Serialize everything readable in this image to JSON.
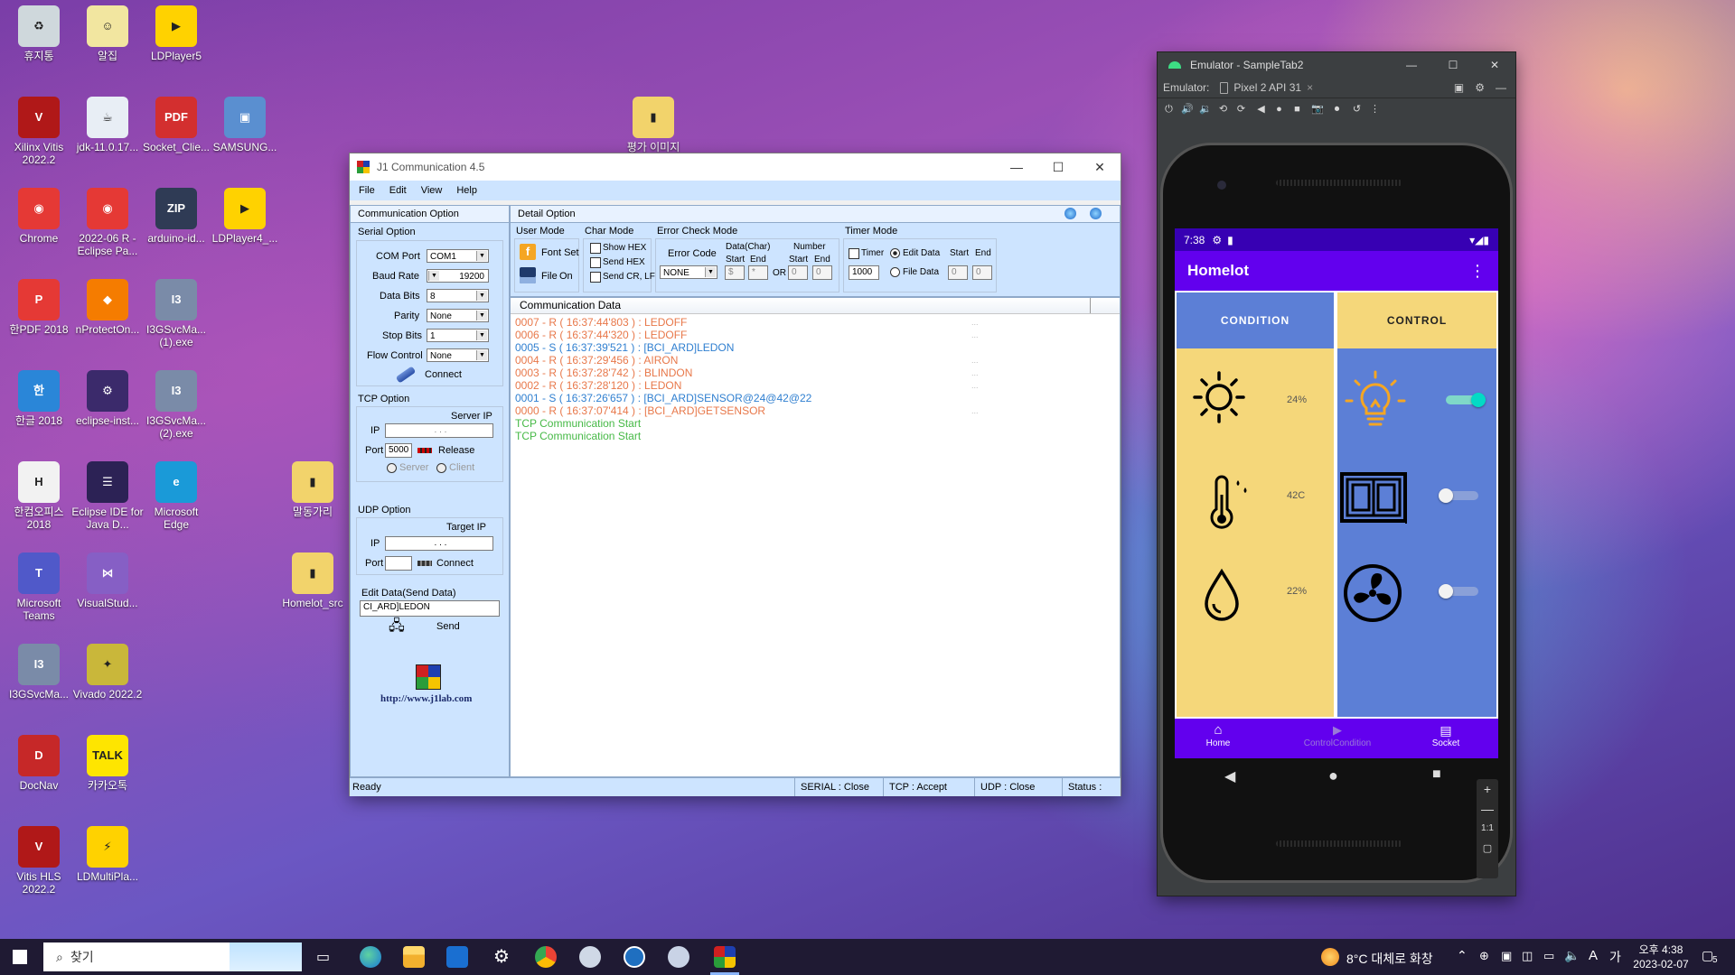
{
  "desktop": {
    "icons": [
      {
        "label": "휴지통",
        "icon": "recycle-bin-icon",
        "color": "#cfd8dc",
        "glyph": "♻"
      },
      {
        "label": "알집",
        "icon": "alzip-icon",
        "color": "#f2e6a0",
        "glyph": "☺"
      },
      {
        "label": "LDPlayer5",
        "icon": "ldplayer-icon",
        "color": "#ffd200",
        "glyph": "▶"
      },
      {
        "label": "Xilinx Vitis 2022.2",
        "icon": "vitis-icon",
        "color": "#b01818",
        "glyph": "V"
      },
      {
        "label": "jdk-11.0.17...",
        "icon": "java-icon",
        "color": "#e8eef5",
        "glyph": "☕"
      },
      {
        "label": "Socket_Clie...",
        "icon": "pdf-icon",
        "color": "#d32f2f",
        "glyph": "PDF"
      },
      {
        "label": "SAMSUNG...",
        "icon": "samsung-setup-icon",
        "color": "#5a8fd0",
        "glyph": "▣"
      },
      {
        "label": "Chrome",
        "icon": "chrome-icon",
        "color": "#e53935",
        "glyph": "◉"
      },
      {
        "label": "2022-06 R - Eclipse Pa...",
        "icon": "chrome-icon",
        "color": "#e53935",
        "glyph": "◉"
      },
      {
        "label": "arduino-id...",
        "icon": "zip-icon",
        "color": "#2f3b55",
        "glyph": "ZIP"
      },
      {
        "label": "LDPlayer4_...",
        "icon": "ldplayer-icon",
        "color": "#ffd200",
        "glyph": "▶"
      },
      {
        "label": "한PDF 2018",
        "icon": "hanpdf-icon",
        "color": "#e53935",
        "glyph": "P"
      },
      {
        "label": "nProtectOn...",
        "icon": "nprotect-icon",
        "color": "#f57c00",
        "glyph": "◆"
      },
      {
        "label": "I3GSvcMa... (1).exe",
        "icon": "installer-icon",
        "color": "#7a8ba8",
        "glyph": "I3"
      },
      {
        "label": "한글 2018",
        "icon": "hangul-icon",
        "color": "#2a86d8",
        "glyph": "한"
      },
      {
        "label": "eclipse-inst...",
        "icon": "eclipse-installer-icon",
        "color": "#3b2a6b",
        "glyph": "⚙"
      },
      {
        "label": "I3GSvcMa... (2).exe",
        "icon": "installer-icon",
        "color": "#7a8ba8",
        "glyph": "I3"
      },
      {
        "label": "한컴오피스 2018",
        "icon": "hancom-icon",
        "color": "#f2f2f2",
        "glyph": "H"
      },
      {
        "label": "Eclipse IDE for Java D...",
        "icon": "eclipse-icon",
        "color": "#2c2255",
        "glyph": "☰"
      },
      {
        "label": "Microsoft Edge",
        "icon": "edge-icon",
        "color": "#1a9ad8",
        "glyph": "e"
      },
      {
        "label": "Microsoft Teams",
        "icon": "teams-icon",
        "color": "#5059c9",
        "glyph": "T"
      },
      {
        "label": "VisualStud...",
        "icon": "visual-studio-icon",
        "color": "#865fc5",
        "glyph": "⋈"
      },
      {
        "label": "I3GSvcMa...",
        "icon": "installer-icon",
        "color": "#7a8ba8",
        "glyph": "I3"
      },
      {
        "label": "Vivado 2022.2",
        "icon": "vivado-icon",
        "color": "#c9b73a",
        "glyph": "✦"
      },
      {
        "label": "DocNav",
        "icon": "docnav-icon",
        "color": "#c62828",
        "glyph": "D"
      },
      {
        "label": "카카오톡",
        "icon": "kakaotalk-icon",
        "color": "#fee500",
        "glyph": "TALK"
      },
      {
        "label": "Vitis HLS 2022.2",
        "icon": "vitis-icon",
        "color": "#b01818",
        "glyph": "V"
      },
      {
        "label": "LDMultiPla...",
        "icon": "ldmultiplayer-icon",
        "color": "#ffd200",
        "glyph": "⚡"
      },
      {
        "label": "평가 이미지",
        "icon": "folder-icon",
        "color": "#f2d36b",
        "glyph": "▮"
      },
      {
        "label": "말동가리",
        "icon": "folder-icon",
        "color": "#f2d36b",
        "glyph": "▮"
      },
      {
        "label": "Homelot_src",
        "icon": "folder-icon",
        "color": "#f2d36b",
        "glyph": "▮"
      }
    ]
  },
  "j1": {
    "title": "J1 Communication 4.5",
    "menu": [
      "File",
      "Edit",
      "View",
      "Help"
    ],
    "left_header": "Communication Option",
    "serial": {
      "title": "Serial Option",
      "com_port_label": "COM Port",
      "com_port": "COM1",
      "baud_label": "Baud Rate",
      "baud": "19200",
      "data_bits_label": "Data Bits",
      "data_bits": "8",
      "parity_label": "Parity",
      "parity": "None",
      "stop_bits_label": "Stop Bits",
      "stop_bits": "1",
      "flow_label": "Flow Control",
      "flow": "None",
      "connect": "Connect"
    },
    "tcp": {
      "title": "TCP Option",
      "server_ip_label": "Server IP",
      "ip_label": "IP",
      "ip_dots": ".      .      .",
      "port_label": "Port",
      "port": "5000",
      "release": "Release",
      "server": "Server",
      "client": "Client"
    },
    "udp": {
      "title": "UDP Option",
      "target_ip_label": "Target IP",
      "ip_label": "IP",
      "ip_dots": ".      .      .",
      "port_label": "Port",
      "connect": "Connect"
    },
    "edit": {
      "label": "Edit Data(Send Data)",
      "value": "CI_ARD]LEDON",
      "send": "Send"
    },
    "url": "http://www.j1lab.com",
    "detail_header": "Detail Option",
    "user_mode": {
      "title": "User Mode",
      "font_set": "Font Set",
      "file": "File",
      "on": "On"
    },
    "char_mode": {
      "title": "Char Mode",
      "show_hex": "Show HEX",
      "send_hex": "Send HEX",
      "send_crlf": "Send CR, LF"
    },
    "error_mode": {
      "title": "Error Check Mode",
      "error_code_label": "Error Code",
      "error_code": "NONE",
      "data_char": "Data(Char)",
      "start": "Start",
      "end": "End",
      "start_val": "$",
      "end_val": "*",
      "or": "OR",
      "number": "Number",
      "num_start": "0",
      "num_end": "0"
    },
    "timer_mode": {
      "title": "Timer Mode",
      "timer": "Timer",
      "edit_data": "Edit Data",
      "file_data": "File Data",
      "interval": "1000",
      "start": "Start",
      "end": "End",
      "start_val": "0",
      "end_val": "0"
    },
    "comm_header": "Communication Data",
    "log": [
      {
        "text": "0007 - R ( 16:37:44'803  ) : LEDOFF",
        "color": "#e8784a",
        "ellipsis": "..."
      },
      {
        "text": "0006 - R ( 16:37:44'320  ) : LEDOFF",
        "color": "#e8784a",
        "ellipsis": "..."
      },
      {
        "text": "0005 - S ( 16:37:39'521  ) : [BCI_ARD]LEDON",
        "color": "#2f7fd0",
        "ellipsis": ""
      },
      {
        "text": "0004 - R ( 16:37:29'456  ) : AIRON",
        "color": "#e8784a",
        "ellipsis": "..."
      },
      {
        "text": "0003 - R ( 16:37:28'742  ) : BLINDON",
        "color": "#e8784a",
        "ellipsis": "..."
      },
      {
        "text": "0002 - R ( 16:37:28'120  ) : LEDON",
        "color": "#e8784a",
        "ellipsis": "..."
      },
      {
        "text": "0001 - S ( 16:37:26'657  ) : [BCI_ARD]SENSOR@24@42@22",
        "color": "#2f7fd0",
        "ellipsis": ""
      },
      {
        "text": "0000 - R ( 16:37:07'414  ) : [BCI_ARD]GETSENSOR",
        "color": "#e8784a",
        "ellipsis": "..."
      },
      {
        "text": "TCP Communication Start",
        "color": "#46b946",
        "ellipsis": ""
      },
      {
        "text": "TCP Communication Start",
        "color": "#46b946",
        "ellipsis": ""
      }
    ],
    "status": {
      "ready": "Ready",
      "serial": "SERIAL : Close",
      "tcp": "TCP : Accept",
      "udp": "UDP : Close",
      "status": "Status :"
    }
  },
  "emulator": {
    "title": "Emulator - SampleTab2",
    "emulator_label": "Emulator:",
    "device_tab": "Pixel 2 API 31",
    "phone": {
      "time": "7:38",
      "app_title": "Homelot",
      "tab_condition": "CONDITION",
      "tab_control": "CONTROL",
      "readings": [
        {
          "icon": "sun-icon",
          "value": "24%"
        },
        {
          "icon": "thermometer-icon",
          "value": "42C"
        },
        {
          "icon": "water-drop-icon",
          "value": "22%"
        }
      ],
      "controls": [
        {
          "icon": "light-bulb-icon",
          "on": true
        },
        {
          "icon": "window-blind-icon",
          "on": false
        },
        {
          "icon": "fan-icon",
          "on": false
        }
      ],
      "nav": [
        {
          "label": "Home",
          "icon": "home-icon"
        },
        {
          "label": "ControlCondition",
          "icon": "play-icon"
        },
        {
          "label": "Socket",
          "icon": "chat-icon"
        }
      ],
      "accent": "#6200ee",
      "condition_color": "#5c7fd6",
      "control_color": "#f5d77a"
    },
    "zoom_fit": "1:1"
  },
  "taskbar": {
    "search_placeholder": "찾기",
    "weather": "8°C  대체로 화창",
    "ime": "A",
    "ime_mode": "가",
    "time": "오후 4:38",
    "date": "2023-02-07",
    "notifications": "5"
  }
}
